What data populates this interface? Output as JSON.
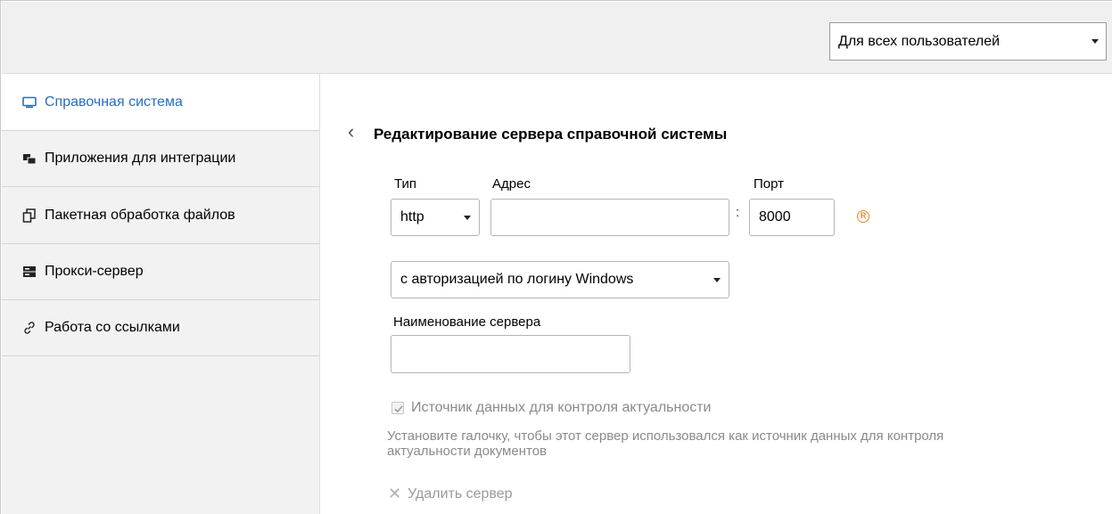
{
  "header": {
    "scope_select": {
      "value": "Для всех пользователей"
    }
  },
  "sidebar": {
    "items": [
      {
        "label": "Справочная система",
        "icon": "monitor-icon",
        "active": true
      },
      {
        "label": "Приложения для интеграции",
        "icon": "windows-icon",
        "active": false
      },
      {
        "label": "Пакетная обработка файлов",
        "icon": "copy-icon",
        "active": false
      },
      {
        "label": "Прокси-сервер",
        "icon": "server-icon",
        "active": false
      },
      {
        "label": "Работа со ссылками",
        "icon": "link-icon",
        "active": false
      }
    ]
  },
  "main": {
    "title": "Редактирование сервера справочной системы",
    "type_label": "Тип",
    "type_value": "http",
    "address_label": "Адрес",
    "address_value": "",
    "port_label": "Порт",
    "port_value": "8000",
    "port_separator": ":",
    "auth_select_value": "с авторизацией по логину Windows",
    "server_name_label": "Наименование сервера",
    "server_name_value": "",
    "actuality_checkbox": {
      "checked": true,
      "label": "Источник данных для контроля актуальности"
    },
    "hint": "Установите галочку, чтобы этот сервер использовался как источник данных для контроля актуальности документов",
    "delete_label": "Удалить сервер"
  },
  "colors": {
    "active_nav_text": "#2a6ebd",
    "sidebar_bg": "#f2f2f2",
    "header_bg": "#f0f0f0",
    "registered_icon": "#e8892a",
    "disabled_text": "#8a8a8a"
  }
}
